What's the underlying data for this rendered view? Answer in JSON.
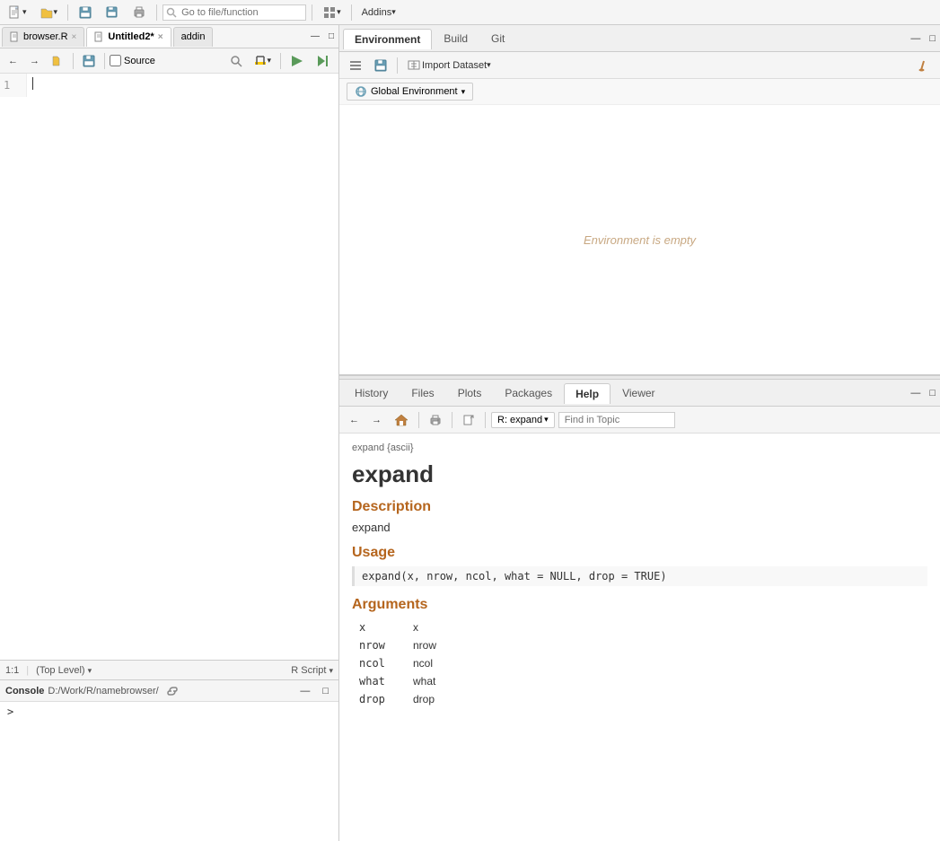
{
  "topToolbar": {
    "saveLabel": "💾",
    "goToFilePlaceholder": "Go to file/function",
    "addinsLabel": "Addins"
  },
  "editorTabs": [
    {
      "label": "browser.R",
      "active": false,
      "closable": true
    },
    {
      "label": "Untitled2*",
      "active": true,
      "closable": true
    },
    {
      "label": "addin",
      "active": false,
      "closable": false
    }
  ],
  "editorToolbar": {
    "sourceLabel": "Source"
  },
  "editor": {
    "lineNumbers": [
      "1"
    ],
    "cursor": ""
  },
  "statusBar": {
    "position": "1:1",
    "scope": "(Top Level)",
    "fileType": "R Script"
  },
  "console": {
    "title": "Console",
    "path": "D:/Work/R/namebrowser/",
    "prompt": ">"
  },
  "envPanel": {
    "tabs": [
      "Environment",
      "Build",
      "Git"
    ],
    "activeTab": "Environment",
    "globalEnvLabel": "Global Environment",
    "emptyText": "Environment is empty"
  },
  "helpPanel": {
    "tabs": [
      "History",
      "Files",
      "Plots",
      "Packages",
      "Help",
      "Viewer"
    ],
    "activeTab": "Help",
    "navDropdown": "R: expand",
    "findPlaceholder": "Find in Topic",
    "breadcrumb": "expand {ascii}",
    "title": "expand",
    "sections": [
      {
        "id": "description",
        "heading": "Description",
        "body": "expand"
      },
      {
        "id": "usage",
        "heading": "Usage",
        "code": "expand(x, nrow, ncol, what = NULL, drop = TRUE)"
      },
      {
        "id": "arguments",
        "heading": "Arguments",
        "args": [
          {
            "name": "x",
            "desc": "x"
          },
          {
            "name": "nrow",
            "desc": "nrow"
          },
          {
            "name": "ncol",
            "desc": "ncol"
          },
          {
            "name": "what",
            "desc": "what"
          },
          {
            "name": "drop",
            "desc": "drop"
          }
        ]
      }
    ]
  }
}
